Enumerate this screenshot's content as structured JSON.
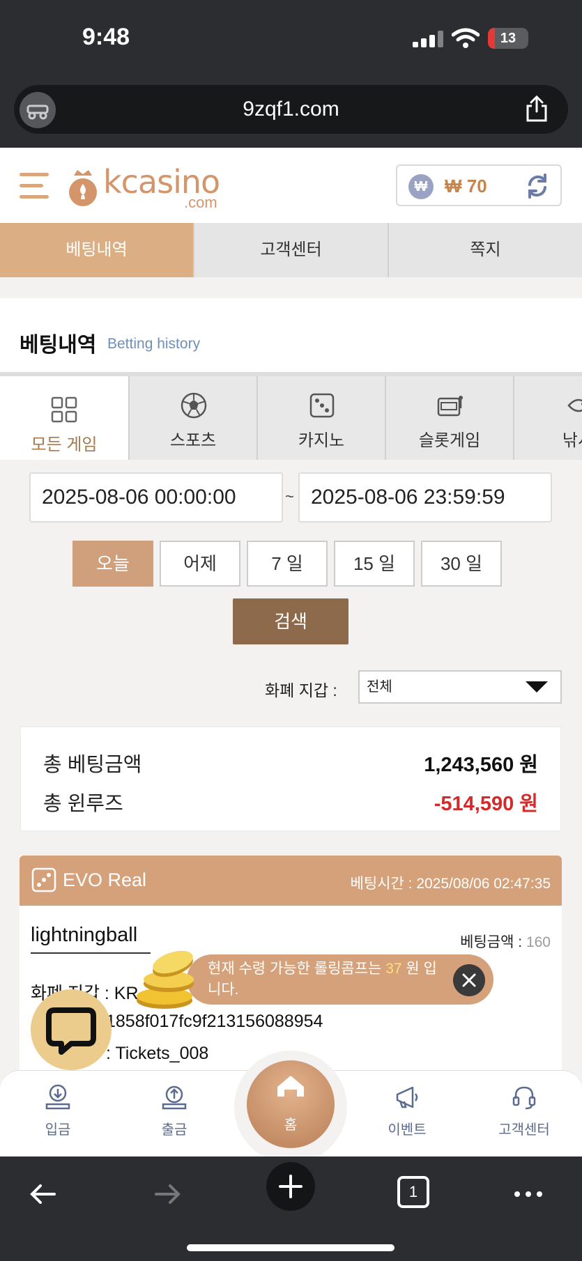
{
  "status": {
    "time": "9:48",
    "battery": "13"
  },
  "browser": {
    "url": "9zqf1.com",
    "tab_count": "1"
  },
  "header": {
    "logo_main": "kcasino",
    "logo_sub": ".com",
    "wallet_symbol": "₩",
    "balance": "₩ 70"
  },
  "top_tabs": [
    {
      "label": "베팅내역"
    },
    {
      "label": "고객센터"
    },
    {
      "label": "쪽지"
    }
  ],
  "history": {
    "title": "베팅내역",
    "subtitle": "Betting history"
  },
  "game_tabs": [
    {
      "label": "모든 게임",
      "icon": "grid-icon"
    },
    {
      "label": "스포츠",
      "icon": "soccer-ball-icon"
    },
    {
      "label": "카지노",
      "icon": "dice-icon"
    },
    {
      "label": "슬롯게임",
      "icon": "slot-machine-icon"
    },
    {
      "label": "낚시",
      "icon": "fish-icon"
    }
  ],
  "filters": {
    "date_from": "2025-08-06 00:00:00",
    "separator": "~",
    "date_to": "2025-08-06 23:59:59",
    "periods": [
      "오늘",
      "어제",
      "7 일",
      "15 일",
      "30 일"
    ],
    "search_label": "검색",
    "currency_label": "화폐 지갑 :",
    "currency_value": "전체"
  },
  "summary": {
    "total_bet_label": "총 베팅금액",
    "total_bet_value": "1,243,560 원",
    "total_winloss_label": "총 윈루즈",
    "total_winloss_value": "-514,590 원"
  },
  "bet": {
    "provider": "EVO Real",
    "time_label": "베팅시간 :",
    "time_value": "2025/08/06 02:47:35",
    "game": "lightningball",
    "amount_label": "베팅금액 :",
    "amount_value": "160",
    "currency_line": "화폐 지갑 : KR",
    "id_line": "1858f017fc9f213156088954",
    "ticket_line": ": Tickets_008"
  },
  "toast": {
    "text_before": "현재 수령 가능한 롤링콤프는 ",
    "amount": "37",
    "text_after": " 원 입니다."
  },
  "bottom_nav": {
    "deposit": "입금",
    "withdraw": "출금",
    "home": "홈",
    "event": "이벤트",
    "support": "고객센터"
  },
  "colors": {
    "accent": "#dcae83",
    "brand": "#d4956b",
    "negative": "#d32b2b",
    "dark_button": "#8c6a4b"
  }
}
